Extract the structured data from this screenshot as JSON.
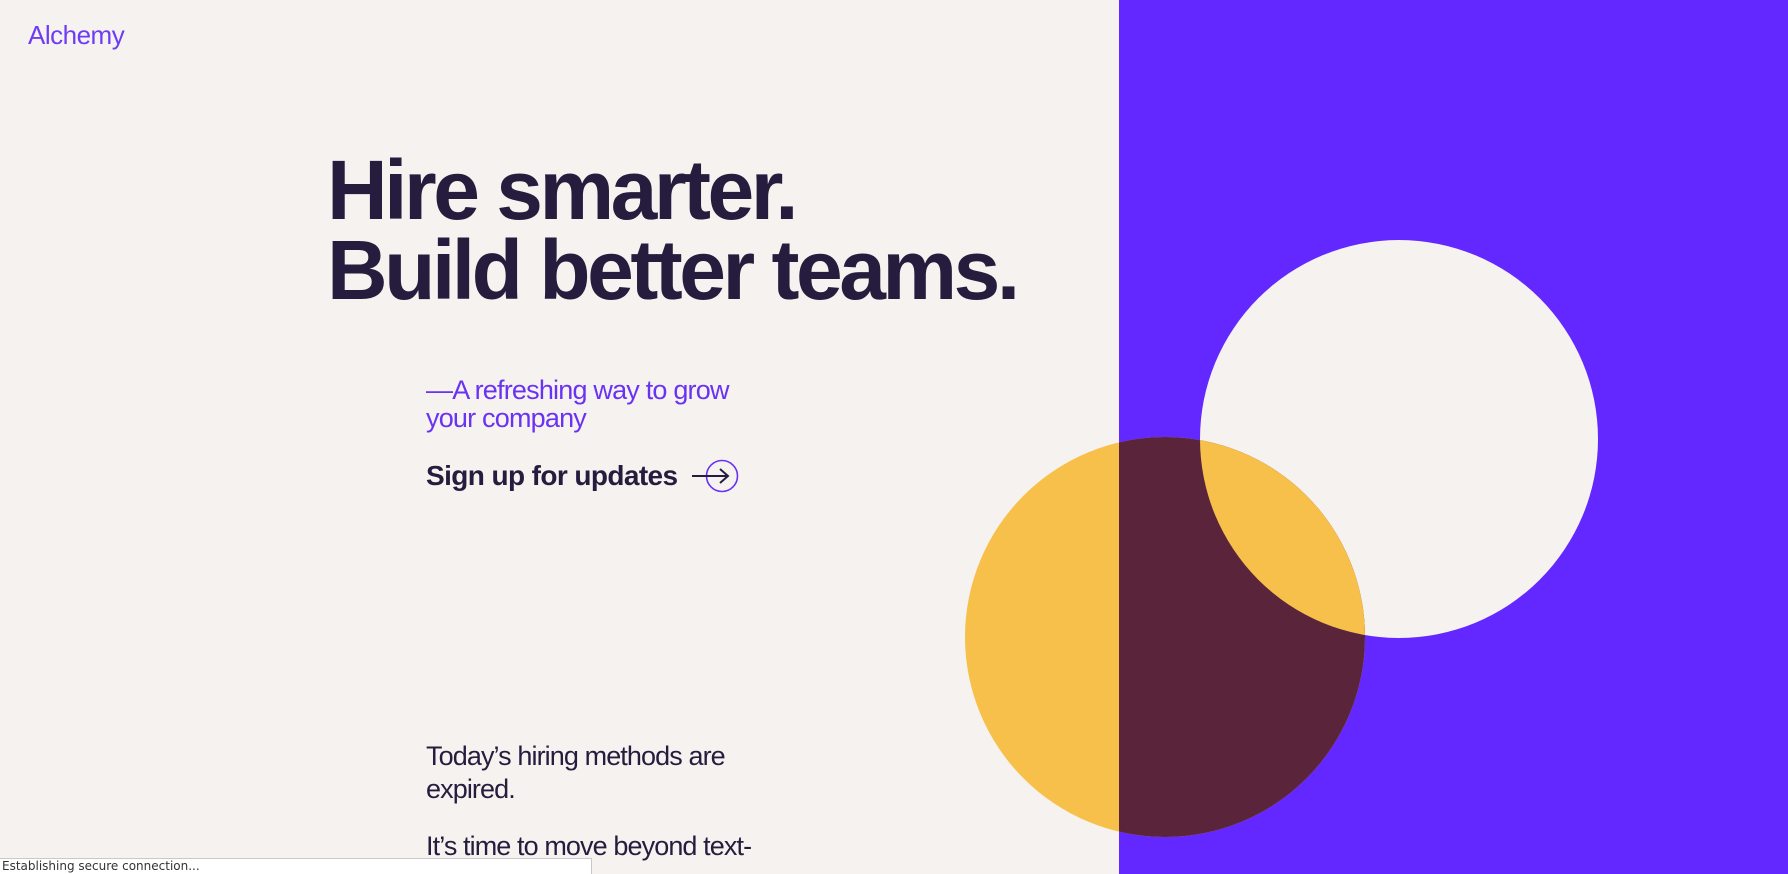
{
  "brand": {
    "logo_text": "Alchemy"
  },
  "hero": {
    "title_line1": "Hire smarter.",
    "title_line2": "Build better teams.",
    "tagline": "—A refreshing way to grow your company",
    "signup_label": "Sign up for updates",
    "signup_icon": "arrow-right-circle-icon"
  },
  "intro": {
    "paragraphs": [
      "Today’s hiring methods are expired.",
      "It’s time to move beyond text-"
    ]
  },
  "status_bar": {
    "text": "Establishing secure connection..."
  },
  "colors": {
    "background": "#f6f2ef",
    "accent_purple": "#6228ff",
    "heading_ink": "#261c3d",
    "circle_yellow": "#f6c04a",
    "circle_overlap": "#5a243b",
    "circle_cream": "#f6f2ef"
  }
}
